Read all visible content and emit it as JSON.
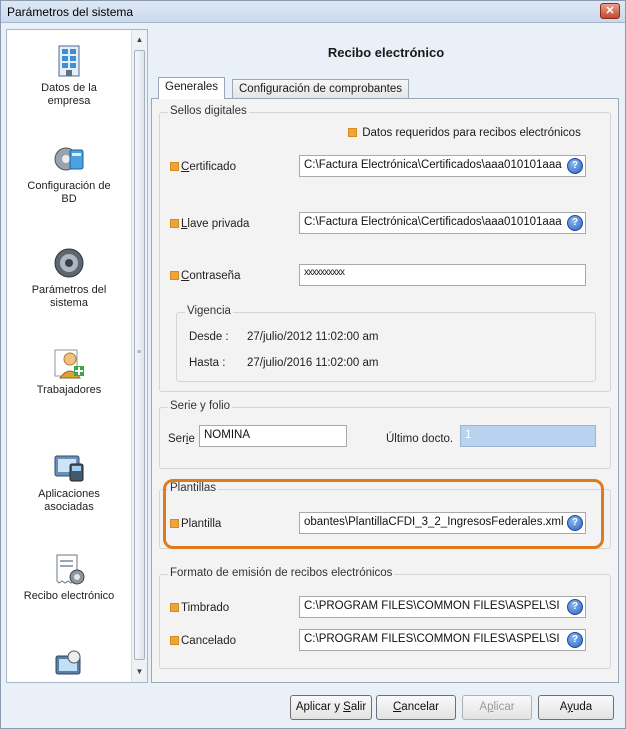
{
  "window": {
    "title": "Parámetros del sistema",
    "close_glyph": "✕"
  },
  "sidebar": {
    "items": [
      {
        "label": "Datos de la\nempresa",
        "icon": "building-icon"
      },
      {
        "label": "Configuración de\nBD",
        "icon": "database-gear-icon"
      },
      {
        "label": "Parámetros del\nsistema",
        "icon": "gear-icon"
      },
      {
        "label": "Trabajadores",
        "icon": "workers-icon"
      },
      {
        "label": "Aplicaciones\nasociadas",
        "icon": "applications-icon"
      },
      {
        "label": "Recibo electrónico",
        "icon": "receipt-icon"
      },
      {
        "label": "",
        "icon": "monitor-icon"
      }
    ]
  },
  "main": {
    "heading": "Recibo electrónico",
    "tabs": [
      {
        "label": "Generales",
        "active": true
      },
      {
        "label": "Configuración de comprobantes",
        "active": false
      }
    ]
  },
  "sellos": {
    "title": "Sellos digitales",
    "required_note": "Datos requeridos para recibos electrónicos",
    "certificado": {
      "label": "Certificado",
      "accesskey": "C",
      "rest": "ertificado",
      "value": "C:\\Factura Electrónica\\Certificados\\aaa010101aaa"
    },
    "llave": {
      "label": "Llave privada",
      "accesskey": "L",
      "rest": "lave privada",
      "value": "C:\\Factura Electrónica\\Certificados\\aaa010101aaa"
    },
    "contrasena": {
      "label": "Contraseña",
      "accesskey": "C",
      "rest": "ontraseña",
      "value": "xxxxxxxxxx"
    },
    "vigencia": {
      "title": "Vigencia",
      "desde_label": "Desde :",
      "desde_value": "27/julio/2012 11:02:00 am",
      "hasta_label": "Hasta :",
      "hasta_value": "27/julio/2016 11:02:00 am"
    }
  },
  "serie": {
    "title": "Serie y folio",
    "serie_label_pre": "Ser",
    "serie_label_key": "i",
    "serie_label_post": "e",
    "serie_value": "NOMINA",
    "ultimo_label": "Último docto.",
    "ultimo_value": "1"
  },
  "plantillas": {
    "title": "Plantillas",
    "plantilla_label": "Plantilla",
    "plantilla_value": "obantes\\PlantillaCFDI_3_2_IngresosFederales.xml"
  },
  "formato": {
    "title": "Formato de emisión de recibos electrónicos",
    "timbrado_label": "Timbrado",
    "timbrado_value": "C:\\PROGRAM FILES\\COMMON FILES\\ASPEL\\SI",
    "cancelado_label": "Cancelado",
    "cancelado_value": "C:\\PROGRAM FILES\\COMMON FILES\\ASPEL\\SI"
  },
  "buttons": {
    "aplicar_salir": {
      "pre": "Aplicar y ",
      "key": "S",
      "post": "alir"
    },
    "cancelar": {
      "key": "C",
      "post": "ancelar"
    },
    "aplicar": {
      "pre": "A",
      "key": "p",
      "post": "licar"
    },
    "ayuda": {
      "pre": "A",
      "key": "y",
      "post": "uda"
    }
  },
  "colors": {
    "required": "#f0a33a",
    "highlight": "#e07a20",
    "help": "#2b62c3"
  }
}
